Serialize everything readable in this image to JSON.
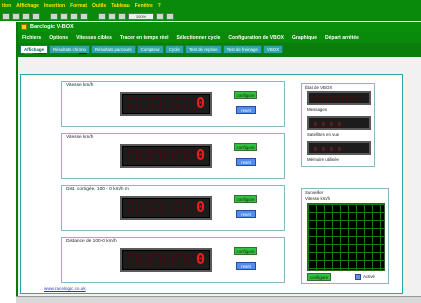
{
  "host_menu": [
    "tion",
    "Affichage",
    "Insertion",
    "Format",
    "Outils",
    "Tableau",
    "Fenêtre",
    "?"
  ],
  "host_toolbar": {
    "zoom": "100%"
  },
  "window": {
    "title": "Barclogic V-BOX"
  },
  "menu": [
    "Fichiers",
    "Options",
    "Vitesses cibles",
    "Tracer en temps réel",
    "Sélectionner cycle",
    "Configuration de VBOX",
    "Graphique",
    "Départ arrêtée"
  ],
  "tabs": [
    "Affichage",
    "Résultats chrono",
    "Résultats parcours",
    "Compteur",
    "Cycle",
    "Test de reprise",
    "Test de freinage",
    "VBOX"
  ],
  "groups": [
    {
      "title": "Vitesse km/h",
      "value": "0",
      "configure": "configure",
      "reset": "reset"
    },
    {
      "title": "Vitesse km/h",
      "value": "0",
      "configure": "configure",
      "reset": "reset"
    },
    {
      "title": "Dist. corrigée, 100 - 0 km/h m",
      "value": "0",
      "configure": "configure",
      "reset": "reset"
    },
    {
      "title": "Distance de 100-0 km/h",
      "value": "0",
      "configure": "configure",
      "reset": "reset"
    }
  ],
  "vbox_state": {
    "title": "État de VBOX",
    "messages_label": "Messages",
    "satellites_label": "Satellites en vue",
    "memory_label": "Mémoire utilisée"
  },
  "surveiller": {
    "title": "Surveiller",
    "subtitle": "Vitesse km/h",
    "configure": "configure",
    "active_label": "Activé"
  },
  "link": "www.racelogic.co.uk",
  "colors": {
    "app_green": "#0a8a0a",
    "tab_teal": "#2aa7a7",
    "lcd_red": "#e81f1f",
    "configure_green": "#2ec23e",
    "reset_blue": "#4f8df0"
  }
}
